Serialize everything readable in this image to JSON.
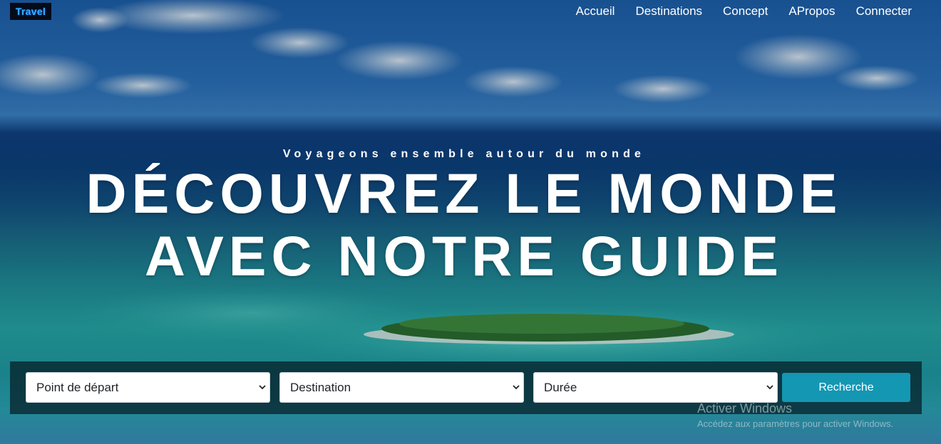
{
  "logo": {
    "text": "Travel"
  },
  "nav": {
    "items": [
      "Accueil",
      "Destinations",
      "Concept",
      "APropos",
      "Connecter"
    ]
  },
  "hero": {
    "tagline": "Voyageons ensemble autour du monde",
    "headline_line1": "DÉCOUVREZ LE MONDE",
    "headline_line2": "AVEC NOTRE GUIDE"
  },
  "search": {
    "departure_selected": "Point de départ",
    "destination_selected": "Destination",
    "duration_selected": "Durée",
    "button_label": "Recherche"
  },
  "watermark": {
    "title": "Activer Windows",
    "subtitle": "Accédez aux paramètres pour activer Windows."
  },
  "colors": {
    "accent_button": "#1497b3",
    "logo_text": "#3ab0ff",
    "nav_text": "#ffffff"
  }
}
